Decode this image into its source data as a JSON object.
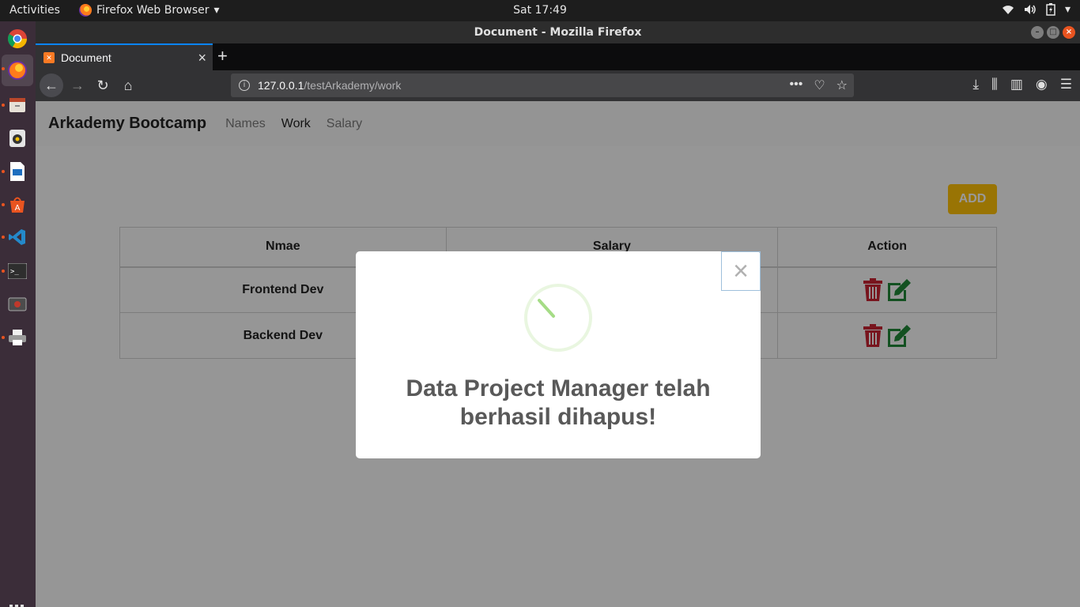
{
  "topbar": {
    "activities": "Activities",
    "app_menu": "Firefox Web Browser",
    "clock": "Sat 17:49"
  },
  "window": {
    "title": "Document - Mozilla Firefox"
  },
  "browser": {
    "tab_title": "Document",
    "url_host": "127.0.0.1",
    "url_path": "/testArkademy/work"
  },
  "site": {
    "brand": "Arkademy Bootcamp",
    "nav": [
      "Names",
      "Work",
      "Salary"
    ],
    "add_label": "ADD",
    "table": {
      "headers": [
        "Nmae",
        "Salary",
        "Action"
      ],
      "rows": [
        {
          "name": "Frontend Dev"
        },
        {
          "name": "Backend Dev"
        }
      ]
    }
  },
  "modal": {
    "close_glyph": "×",
    "message": "Data Project Manager telah berhasil dihapus!"
  },
  "colors": {
    "add_button": "#ffc107",
    "delete_icon": "#c82333",
    "edit_icon": "#218838",
    "spinner": "#a5dc86"
  }
}
